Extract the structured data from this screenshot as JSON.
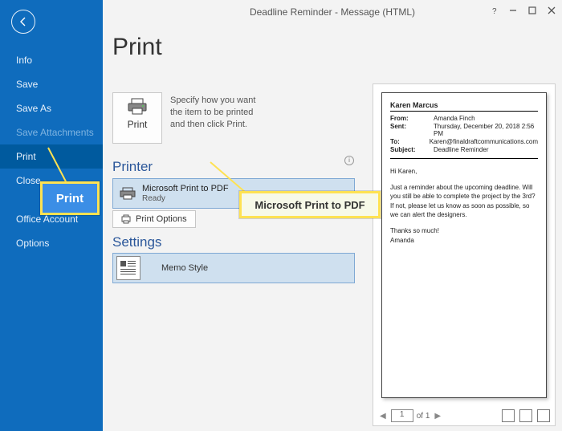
{
  "window": {
    "title": "Deadline Reminder - Message (HTML)"
  },
  "sidebar": {
    "items": [
      {
        "label": "Info"
      },
      {
        "label": "Save"
      },
      {
        "label": "Save As"
      },
      {
        "label": "Save Attachments",
        "dim": true
      },
      {
        "label": "Print",
        "active": true
      },
      {
        "label": "Close"
      },
      {
        "label": "Office Account"
      },
      {
        "label": "Options"
      }
    ]
  },
  "page": {
    "title": "Print",
    "tile_label": "Print",
    "spec": "Specify how you want the item to be printed and then click Print."
  },
  "printer": {
    "heading": "Printer",
    "name": "Microsoft Print to PDF",
    "status": "Ready",
    "options": "Print Options"
  },
  "settings": {
    "heading": "Settings",
    "style": "Memo Style"
  },
  "preview": {
    "name": "Karen Marcus",
    "from_k": "From:",
    "from_v": "Amanda Finch",
    "sent_k": "Sent:",
    "sent_v": "Thursday, December 20, 2018 2:56 PM",
    "to_k": "To:",
    "to_v": "Karen@finaldraftcommunications.com",
    "subj_k": "Subject:",
    "subj_v": "Deadline Reminder",
    "greet": "Hi Karen,",
    "body": "Just a reminder about the upcoming deadline. Will you still be able to complete the project by the 3rd? If not, please let us know as soon as possible, so we can alert the designers.",
    "thx": "Thanks so much!",
    "sig": "Amanda",
    "page_num": "1",
    "page_of": "of 1"
  },
  "callouts": {
    "print": "Print",
    "pdf": "Microsoft Print to PDF"
  }
}
